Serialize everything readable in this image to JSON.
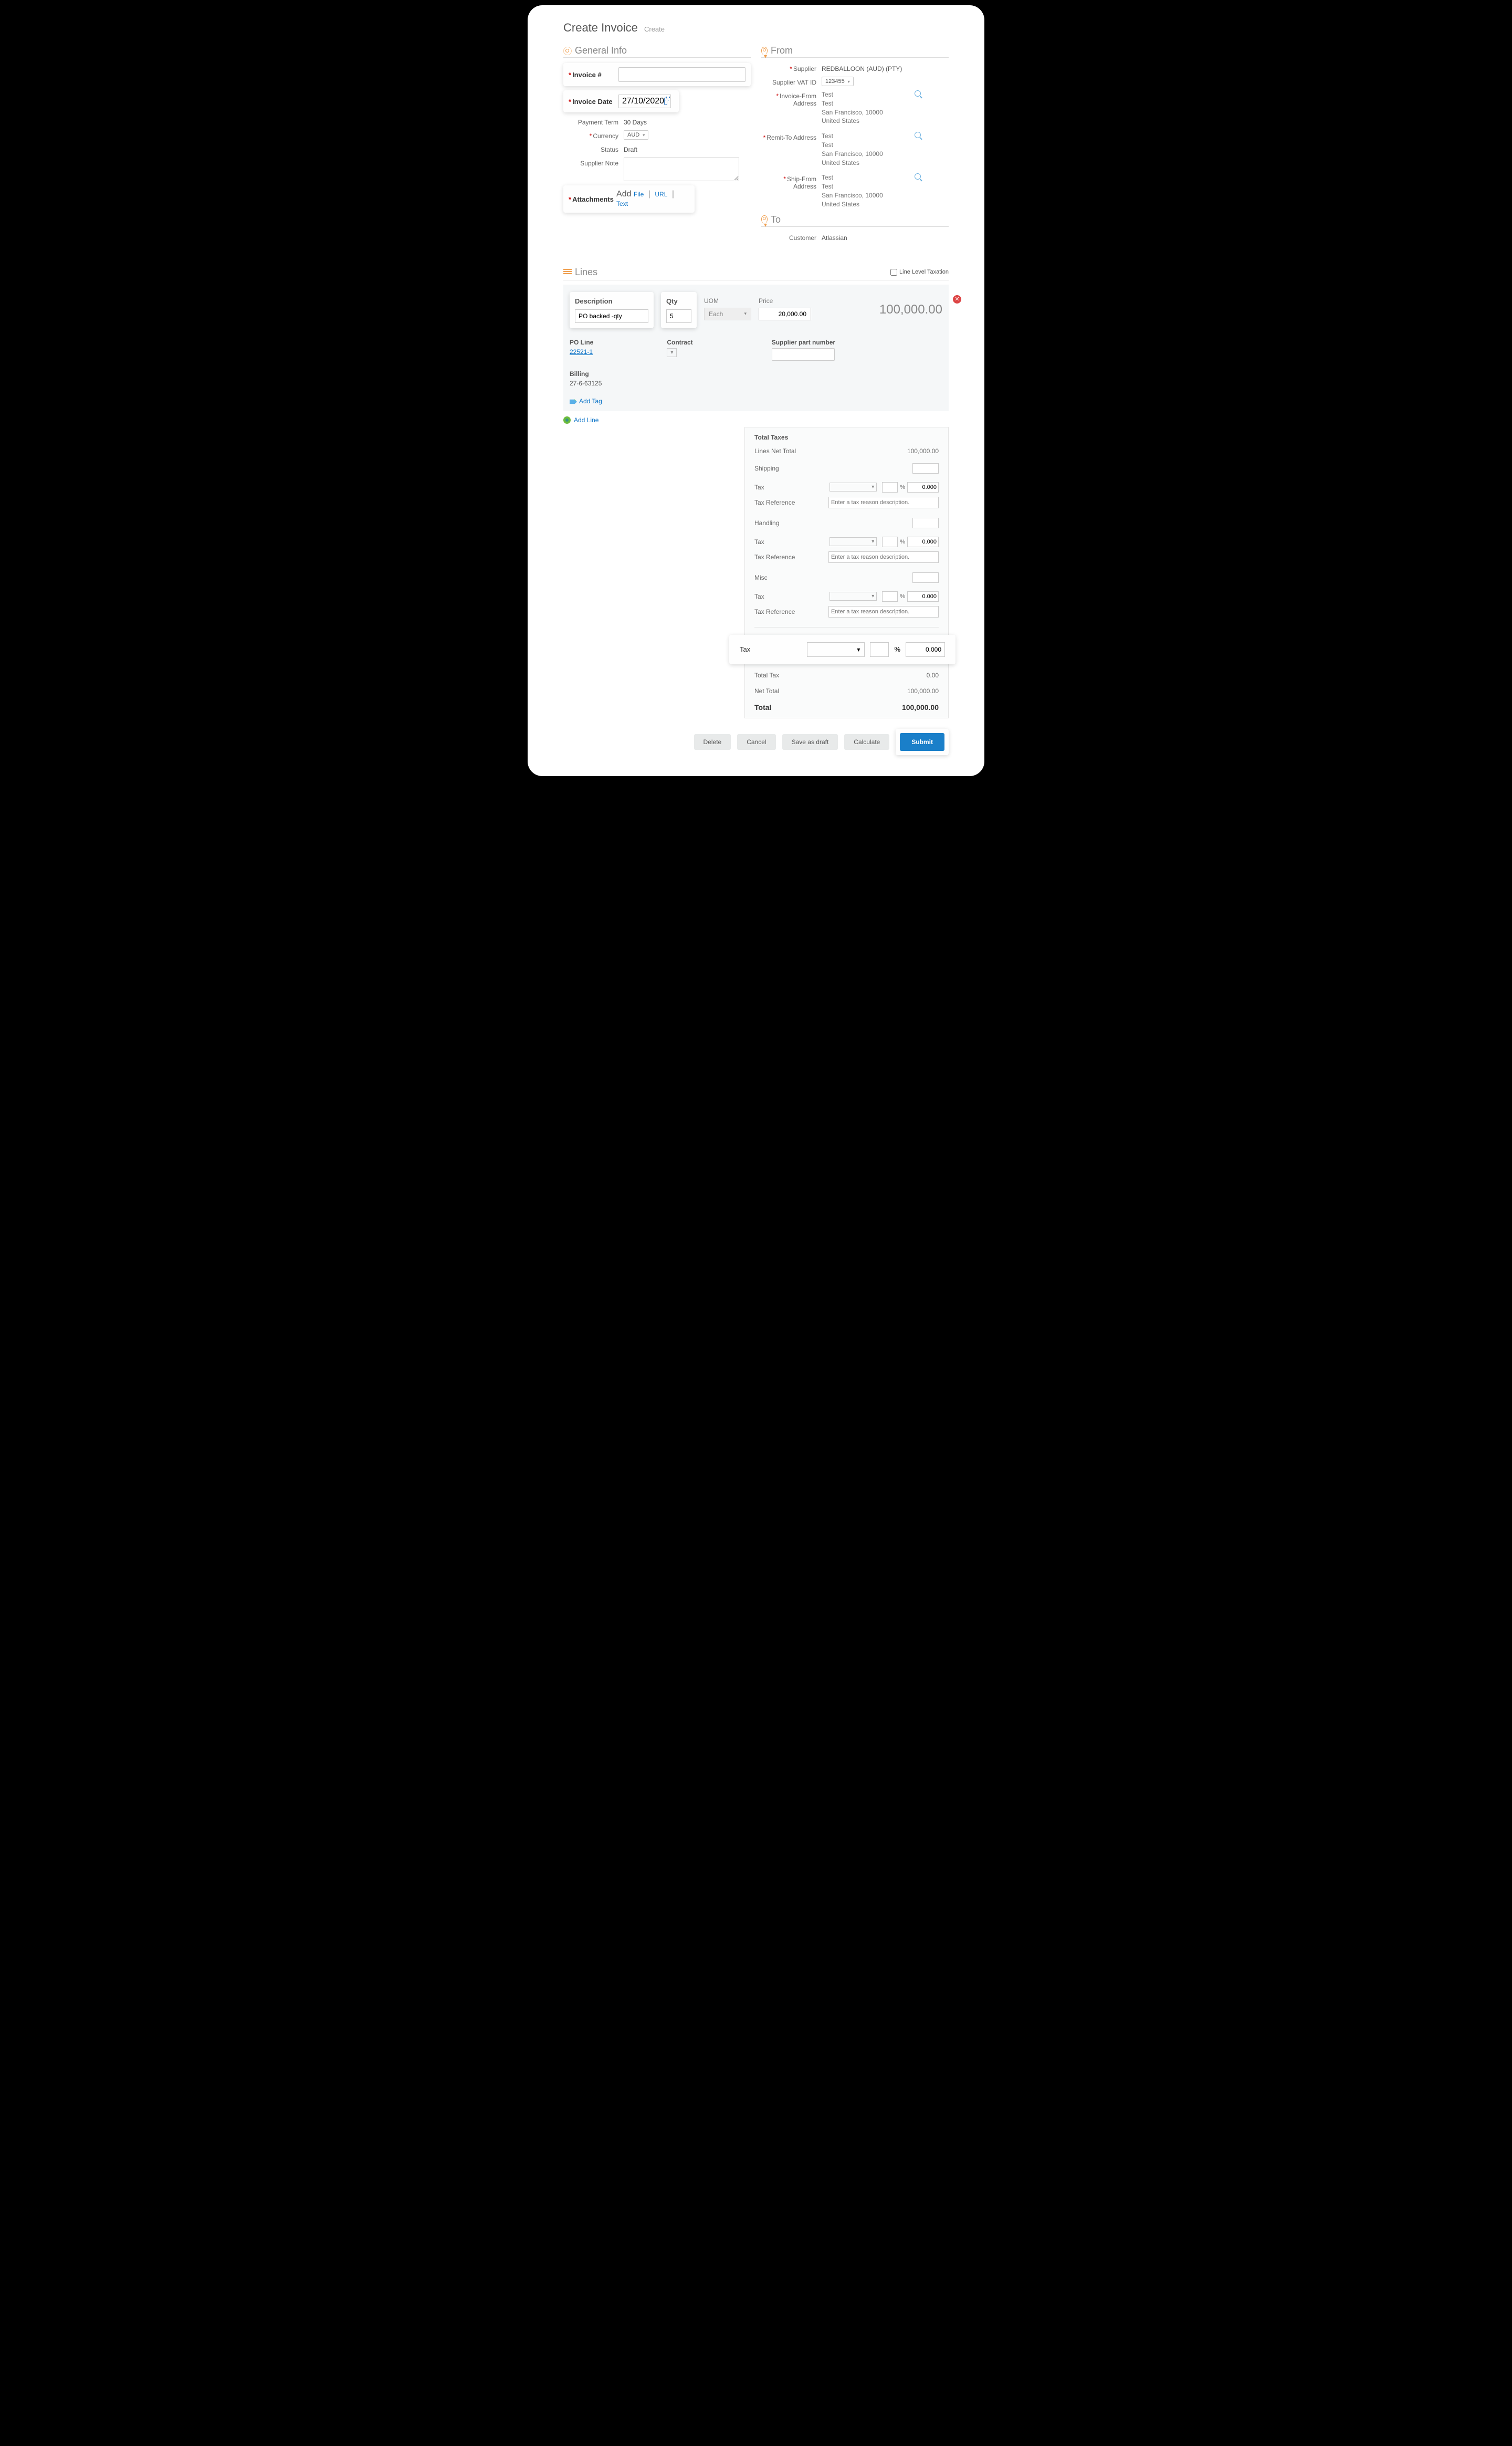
{
  "page": {
    "title": "Create Invoice",
    "sub": "Create"
  },
  "general": {
    "heading": "General Info",
    "invoice_num_label": "Invoice #",
    "invoice_num_value": "",
    "invoice_date_label": "Invoice Date",
    "invoice_date_value": "27/10/2020",
    "payment_term_label": "Payment Term",
    "payment_term_value": "30 Days",
    "currency_label": "Currency",
    "currency_value": "AUD",
    "status_label": "Status",
    "status_value": "Draft",
    "note_label": "Supplier Note",
    "attachments_label": "Attachments",
    "attach_add": "Add",
    "attach_file": "File",
    "attach_url": "URL",
    "attach_text": "Text"
  },
  "from": {
    "heading": "From",
    "supplier_label": "Supplier",
    "supplier_value": "REDBALLOON (AUD) (PTY)",
    "vat_label": "Supplier VAT ID",
    "vat_value": "123455",
    "invoice_from_label": "Invoice-From Address",
    "remit_to_label": "Remit-To Address",
    "ship_from_label": "Ship-From Address",
    "address": {
      "l1": "Test",
      "l2": "Test",
      "l3": "San Francisco, 10000",
      "l4": "United States"
    }
  },
  "to": {
    "heading": "To",
    "customer_label": "Customer",
    "customer_value": "Atlassian"
  },
  "lines": {
    "heading": "Lines",
    "line_level_tax": "Line Level Taxation",
    "desc_label": "Description",
    "desc_value": "PO backed -qty",
    "qty_label": "Qty",
    "qty_value": "5",
    "uom_label": "UOM",
    "uom_value": "Each",
    "price_label": "Price",
    "price_value": "20,000.00",
    "line_total": "100,000.00",
    "po_line_label": "PO Line",
    "po_line_value": "22521-1",
    "contract_label": "Contract",
    "part_label": "Supplier part number",
    "billing_label": "Billing",
    "billing_value": "27-6-63125",
    "add_tag": "Add Tag",
    "add_line": "Add Line"
  },
  "totals": {
    "heading": "Total Taxes",
    "net_total_label": "Lines Net Total",
    "net_total_value": "100,000.00",
    "shipping_label": "Shipping",
    "handling_label": "Handling",
    "misc_label": "Misc",
    "tax_label": "Tax",
    "tax_ref_label": "Tax Reference",
    "tax_ref_placeholder": "Enter a tax reason description.",
    "small_tax_amt": "0.000",
    "big_tax_label": "Tax",
    "big_tax_amt": "0.000",
    "pct": "%",
    "total_tax_label": "Total Tax",
    "total_tax_value": "0.00",
    "net_label": "Net Total",
    "net_value": "100,000.00",
    "final_label": "Total",
    "final_value": "100,000.00"
  },
  "buttons": {
    "delete": "Delete",
    "cancel": "Cancel",
    "draft": "Save as draft",
    "calc": "Calculate",
    "submit": "Submit"
  }
}
